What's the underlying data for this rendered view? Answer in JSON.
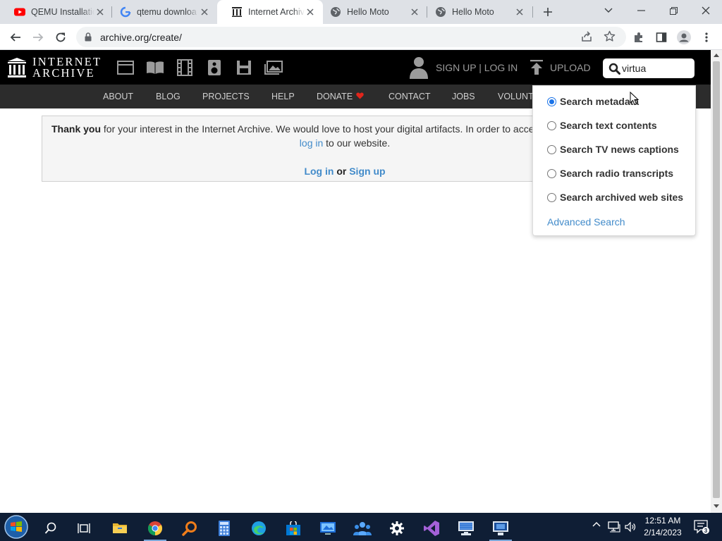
{
  "browser": {
    "tabs": [
      {
        "title": "QEMU Installatio",
        "favicon": "youtube-icon"
      },
      {
        "title": "qtemu downloa",
        "favicon": "google-icon"
      },
      {
        "title": "Internet Archive",
        "favicon": "archive-icon"
      },
      {
        "title": "Hello Moto",
        "favicon": "globe-icon"
      },
      {
        "title": "Hello Moto",
        "favicon": "globe-icon"
      }
    ],
    "active_tab": 2,
    "url": "archive.org/create/"
  },
  "header": {
    "logo_line1": "INTERNET",
    "logo_line2": "ARCHIVE",
    "signup_login": "SIGN UP | LOG IN",
    "upload": "UPLOAD",
    "search_value": "virtua"
  },
  "nav": {
    "items": [
      "ABOUT",
      "BLOG",
      "PROJECTS",
      "HELP",
      "DONATE",
      "CONTACT",
      "JOBS",
      "VOLUNT"
    ]
  },
  "notice": {
    "bold": "Thank you",
    "text1": " for your interest in the Internet Archive. We would love to host your digital artifacts. In order to acce",
    "login_link": "log in",
    "text2": " to our website.",
    "login_btn": "Log in",
    "or": "or",
    "signup_btn": "Sign up"
  },
  "search_dropdown": {
    "options": [
      {
        "label": "Search metadata",
        "checked": true
      },
      {
        "label": "Search text contents",
        "checked": false
      },
      {
        "label": "Search TV news captions",
        "checked": false
      },
      {
        "label": "Search radio transcripts",
        "checked": false
      },
      {
        "label": "Search archived web sites",
        "checked": false
      }
    ],
    "advanced": "Advanced Search"
  },
  "taskbar": {
    "time": "12:51 AM",
    "date": "2/14/2023"
  },
  "colors": {
    "link": "#428bca",
    "header_bg": "#000000",
    "nav_bg": "#2c2c2c",
    "heart": "#e1251b"
  }
}
